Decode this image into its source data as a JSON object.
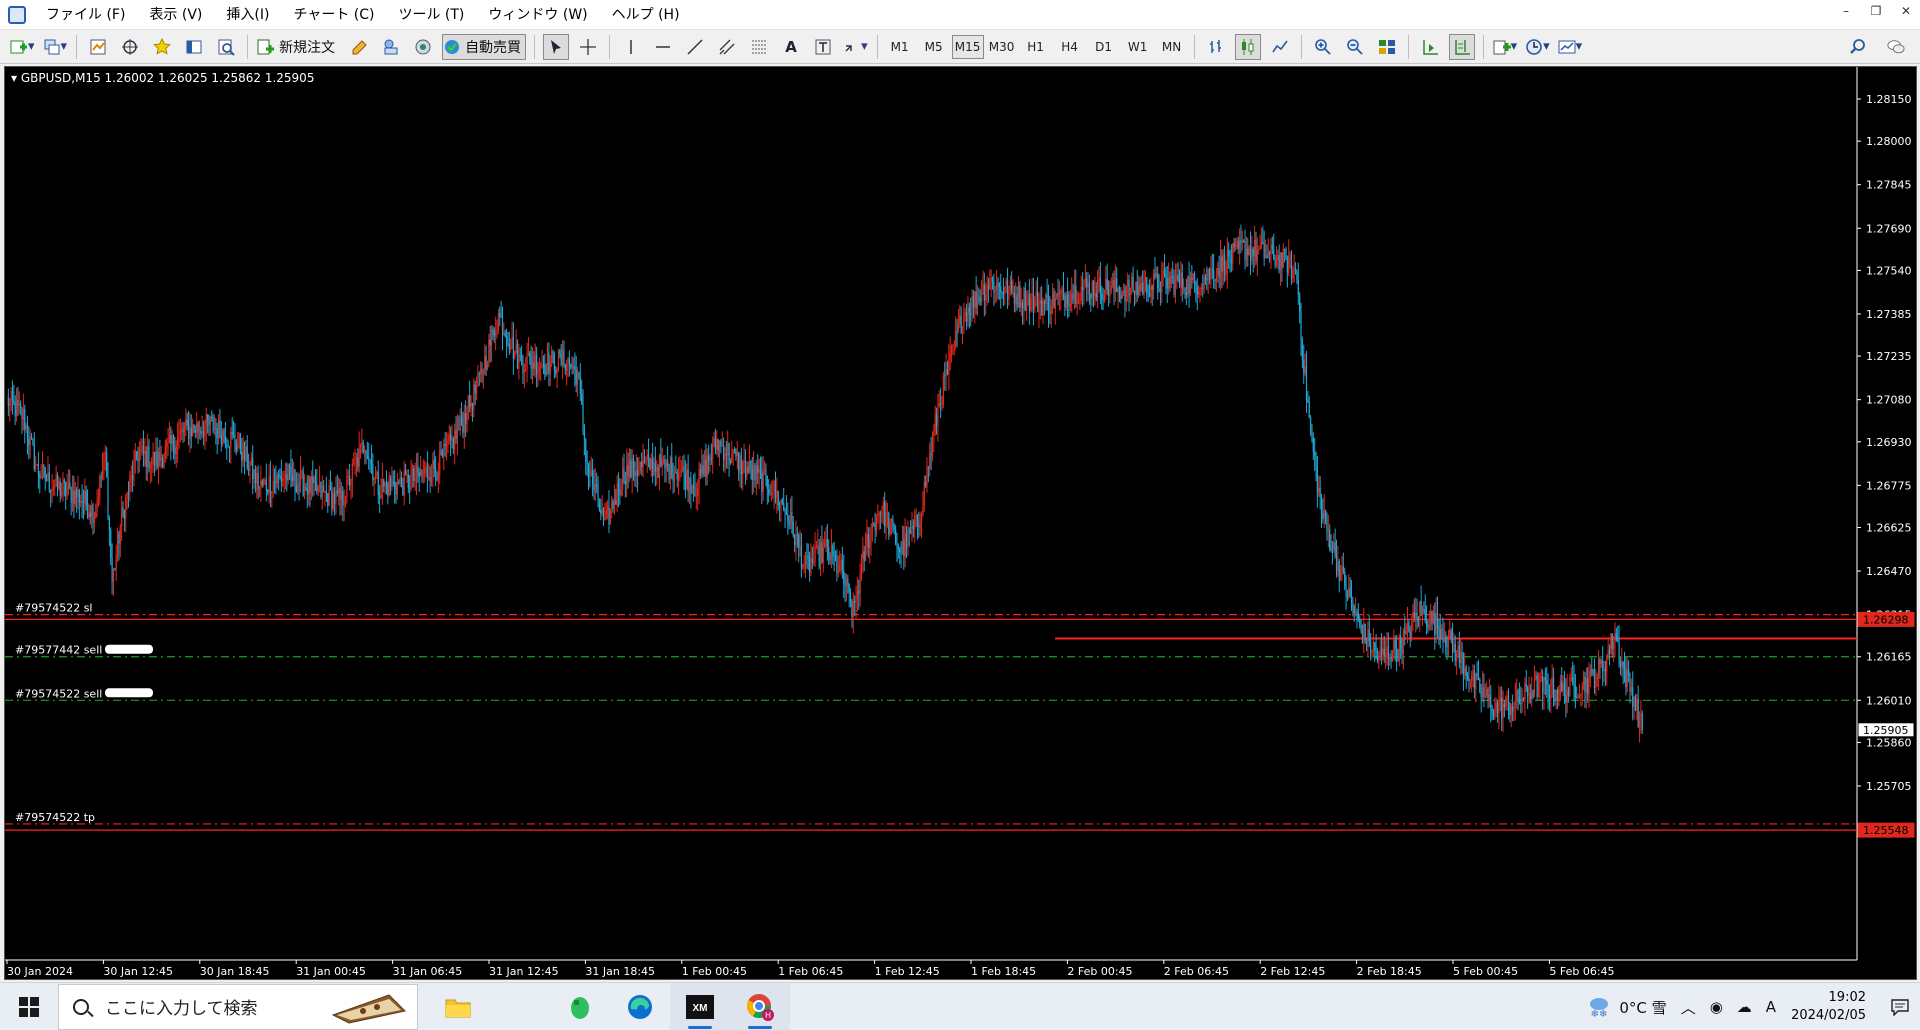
{
  "menu": [
    "ファイル (F)",
    "表示 (V)",
    "挿入(I)",
    "チャート (C)",
    "ツール (T)",
    "ウィンドウ (W)",
    "ヘルプ (H)"
  ],
  "toolbar": {
    "new_order_label": "新規注文",
    "auto_trade_label": "自動売買",
    "timeframes": [
      "M1",
      "M5",
      "M15",
      "M30",
      "H1",
      "H4",
      "D1",
      "W1",
      "MN"
    ],
    "active_timeframe": "M15"
  },
  "chart": {
    "title": "GBPUSD,M15  1.26002 1.26025 1.25862 1.25905",
    "symbol": "GBPUSD",
    "period": "M15",
    "ohlc": {
      "open": 1.26002,
      "high": 1.26025,
      "low": 1.25862,
      "close": 1.25905
    },
    "colors": {
      "background": "#000000",
      "bull": "#e0281c",
      "bear": "#1fa8d6",
      "grid_text": "#ffffff",
      "sl_line": "#ff2020",
      "entry_line": "#1aa31a"
    },
    "price_ticks": [
      "1.28150",
      "1.28000",
      "1.27845",
      "1.27690",
      "1.27540",
      "1.27385",
      "1.27235",
      "1.27080",
      "1.26930",
      "1.26775",
      "1.26625",
      "1.26470",
      "1.26315",
      "1.26165",
      "1.26010",
      "1.25860",
      "1.25705"
    ],
    "time_ticks": [
      "30 Jan 2024",
      "30 Jan 12:45",
      "30 Jan 18:45",
      "31 Jan 00:45",
      "31 Jan 06:45",
      "31 Jan 12:45",
      "31 Jan 18:45",
      "1 Feb 00:45",
      "1 Feb 06:45",
      "1 Feb 12:45",
      "1 Feb 18:45",
      "2 Feb 00:45",
      "2 Feb 06:45",
      "2 Feb 12:45",
      "2 Feb 18:45",
      "5 Feb 00:45",
      "5 Feb 06:45"
    ],
    "current_price_label": "1.25905",
    "highlight_labels": [
      "1.26298",
      "1.25548"
    ],
    "order_labels": [
      {
        "text": "#79574522 sl",
        "price": 1.26315,
        "style": "sl"
      },
      {
        "text": "#79577442 sell",
        "price": 1.26165,
        "style": "entry"
      },
      {
        "text": "#79574522 sell",
        "price": 1.2601,
        "style": "entry"
      },
      {
        "text": "#79574522 tp",
        "price": 1.2557,
        "style": "sl"
      }
    ],
    "horizontal_lines": [
      {
        "price": 1.26315,
        "style": "dash-red"
      },
      {
        "price": 1.26298,
        "style": "solid-red"
      },
      {
        "price": 1.2623,
        "style": "solid-red-partial",
        "from_time": "2 Feb 00:00"
      },
      {
        "price": 1.26165,
        "style": "dash-green"
      },
      {
        "price": 1.2601,
        "style": "dash-green"
      },
      {
        "price": 1.2557,
        "style": "dash-red"
      },
      {
        "price": 1.25548,
        "style": "solid-red"
      }
    ],
    "price_range": [
      1.256,
      1.282
    ],
    "anchors": [
      [
        0,
        1.2708
      ],
      [
        12,
        1.2702
      ],
      [
        22,
        1.2683
      ],
      [
        35,
        1.2677
      ],
      [
        52,
        1.2674
      ],
      [
        64,
        1.2668
      ],
      [
        72,
        1.2688
      ],
      [
        77,
        1.2643
      ],
      [
        84,
        1.2666
      ],
      [
        96,
        1.2689
      ],
      [
        110,
        1.2686
      ],
      [
        130,
        1.2697
      ],
      [
        150,
        1.2699
      ],
      [
        170,
        1.2692
      ],
      [
        185,
        1.2677
      ],
      [
        205,
        1.2681
      ],
      [
        225,
        1.2676
      ],
      [
        245,
        1.2672
      ],
      [
        262,
        1.2693
      ],
      [
        272,
        1.2677
      ],
      [
        290,
        1.2678
      ],
      [
        315,
        1.2684
      ],
      [
        330,
        1.2696
      ],
      [
        345,
        1.2713
      ],
      [
        360,
        1.2738
      ],
      [
        375,
        1.2722
      ],
      [
        395,
        1.2721
      ],
      [
        410,
        1.2722
      ],
      [
        418,
        1.2717
      ],
      [
        425,
        1.2685
      ],
      [
        438,
        1.2663
      ],
      [
        452,
        1.2682
      ],
      [
        470,
        1.2685
      ],
      [
        492,
        1.2683
      ],
      [
        505,
        1.2677
      ],
      [
        520,
        1.2693
      ],
      [
        540,
        1.2684
      ],
      [
        560,
        1.2677
      ],
      [
        572,
        1.2667
      ],
      [
        585,
        1.2648
      ],
      [
        600,
        1.2655
      ],
      [
        612,
        1.2646
      ],
      [
        620,
        1.2632
      ],
      [
        630,
        1.2658
      ],
      [
        640,
        1.267
      ],
      [
        655,
        1.2654
      ],
      [
        668,
        1.2665
      ],
      [
        683,
        1.2707
      ],
      [
        700,
        1.2738
      ],
      [
        720,
        1.275
      ],
      [
        740,
        1.2745
      ],
      [
        760,
        1.2742
      ],
      [
        790,
        1.2748
      ],
      [
        820,
        1.2747
      ],
      [
        850,
        1.275
      ],
      [
        870,
        1.2749
      ],
      [
        885,
        1.2754
      ],
      [
        905,
        1.2762
      ],
      [
        920,
        1.276
      ],
      [
        938,
        1.2757
      ],
      [
        945,
        1.2752
      ],
      [
        950,
        1.272
      ],
      [
        955,
        1.2697
      ],
      [
        963,
        1.2668
      ],
      [
        980,
        1.2642
      ],
      [
        992,
        1.2626
      ],
      [
        1005,
        1.2616
      ],
      [
        1020,
        1.262
      ],
      [
        1035,
        1.2633
      ],
      [
        1050,
        1.2627
      ],
      [
        1062,
        1.2618
      ],
      [
        1075,
        1.2607
      ],
      [
        1090,
        1.2598
      ],
      [
        1105,
        1.26
      ],
      [
        1120,
        1.2606
      ],
      [
        1140,
        1.2604
      ],
      [
        1160,
        1.2608
      ],
      [
        1170,
        1.2614
      ],
      [
        1178,
        1.2625
      ],
      [
        1184,
        1.2612
      ],
      [
        1192,
        1.2602
      ],
      [
        1198,
        1.259
      ]
    ]
  },
  "taskbar": {
    "search_placeholder": "ここに入力して検索",
    "apps": [
      "evernote-icon",
      "edge-icon",
      "xm-trading-icon",
      "chrome-icon"
    ],
    "weather": "0°C  雪",
    "ime": "A",
    "time": "19:02",
    "date": "2024/02/05"
  }
}
